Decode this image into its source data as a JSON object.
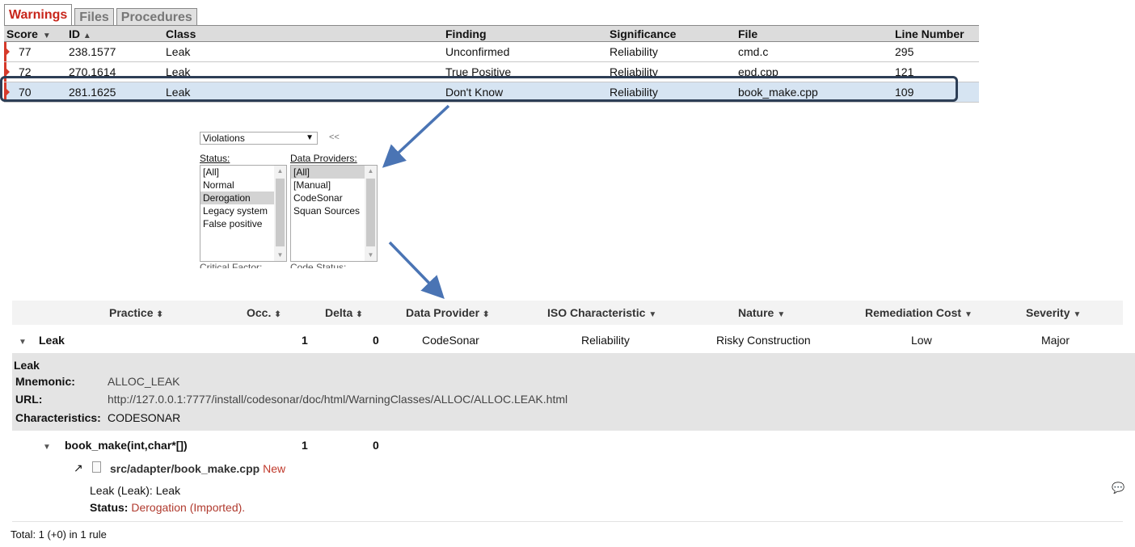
{
  "tabs": [
    "Warnings",
    "Files",
    "Procedures"
  ],
  "warnings": {
    "headers": {
      "score": "Score",
      "score_sort": "▼",
      "id": "ID",
      "id_sort": "▲",
      "class": "Class",
      "finding": "Finding",
      "significance": "Significance",
      "file": "File",
      "line": "Line Number"
    },
    "rows": [
      {
        "score": "77",
        "id": "238.1577",
        "class": "Leak",
        "finding": "Unconfirmed",
        "significance": "Reliability",
        "file": "cmd.c",
        "line": "295"
      },
      {
        "score": "72",
        "id": "270.1614",
        "class": "Leak",
        "finding": "True Positive",
        "significance": "Reliability",
        "file": "epd.cpp",
        "line": "121"
      },
      {
        "score": "70",
        "id": "281.1625",
        "class": "Leak",
        "finding": "Don't Know",
        "significance": "Reliability",
        "file": "book_make.cpp",
        "line": "109"
      }
    ]
  },
  "filter": {
    "view": "Violations",
    "collapse": "<<",
    "status_label": "Status:",
    "status_options": [
      "[All]",
      "Normal",
      "Derogation",
      "Legacy system",
      "False positive"
    ],
    "status_selected": "Derogation",
    "providers_label": "Data Providers:",
    "provider_options": [
      "[All]",
      "[Manual]",
      "CodeSonar",
      "Squan Sources"
    ],
    "provider_selected": "[All]",
    "next_label_1": "Critical Factor:",
    "next_label_2": "Code Status:"
  },
  "grid": {
    "headers": {
      "practice": "Practice",
      "occ": "Occ.",
      "delta": "Delta",
      "provider": "Data Provider",
      "iso": "ISO Characteristic",
      "nature": "Nature",
      "cost": "Remediation Cost",
      "severity": "Severity"
    },
    "rule": {
      "name": "Leak",
      "occ": "1",
      "delta": "0",
      "provider": "CodeSonar",
      "iso": "Reliability",
      "nature": "Risky Construction",
      "cost": "Low",
      "severity": "Major"
    },
    "detail": {
      "title": "Leak",
      "mnemonic_label": "Mnemonic:",
      "mnemonic": "ALLOC_LEAK",
      "url_label": "URL:",
      "url": "http://127.0.0.1:7777/install/codesonar/doc/html/WarningClasses/ALLOC/ALLOC.LEAK.html",
      "characteristics_label": "Characteristics:",
      "characteristics": "CODESONAR"
    },
    "procedure": {
      "name": "book_make(int,char*[])",
      "occ": "1",
      "delta": "0"
    },
    "file": {
      "path": "src/adapter/book_make.cpp",
      "tag": "New"
    },
    "message": "Leak (Leak): Leak",
    "status_label": "Status:",
    "status_value": "Derogation (Imported).",
    "total": "Total: 1 (+0) in 1 rule"
  },
  "colors": {
    "accent_red": "#c8261b",
    "selection": "#d6e4f2",
    "arrow": "#4a74b4"
  },
  "icons": [
    "external-link-icon",
    "file-icon",
    "comment-icon",
    "kebab-icon",
    "chevron-down-icon",
    "sort-icon"
  ]
}
